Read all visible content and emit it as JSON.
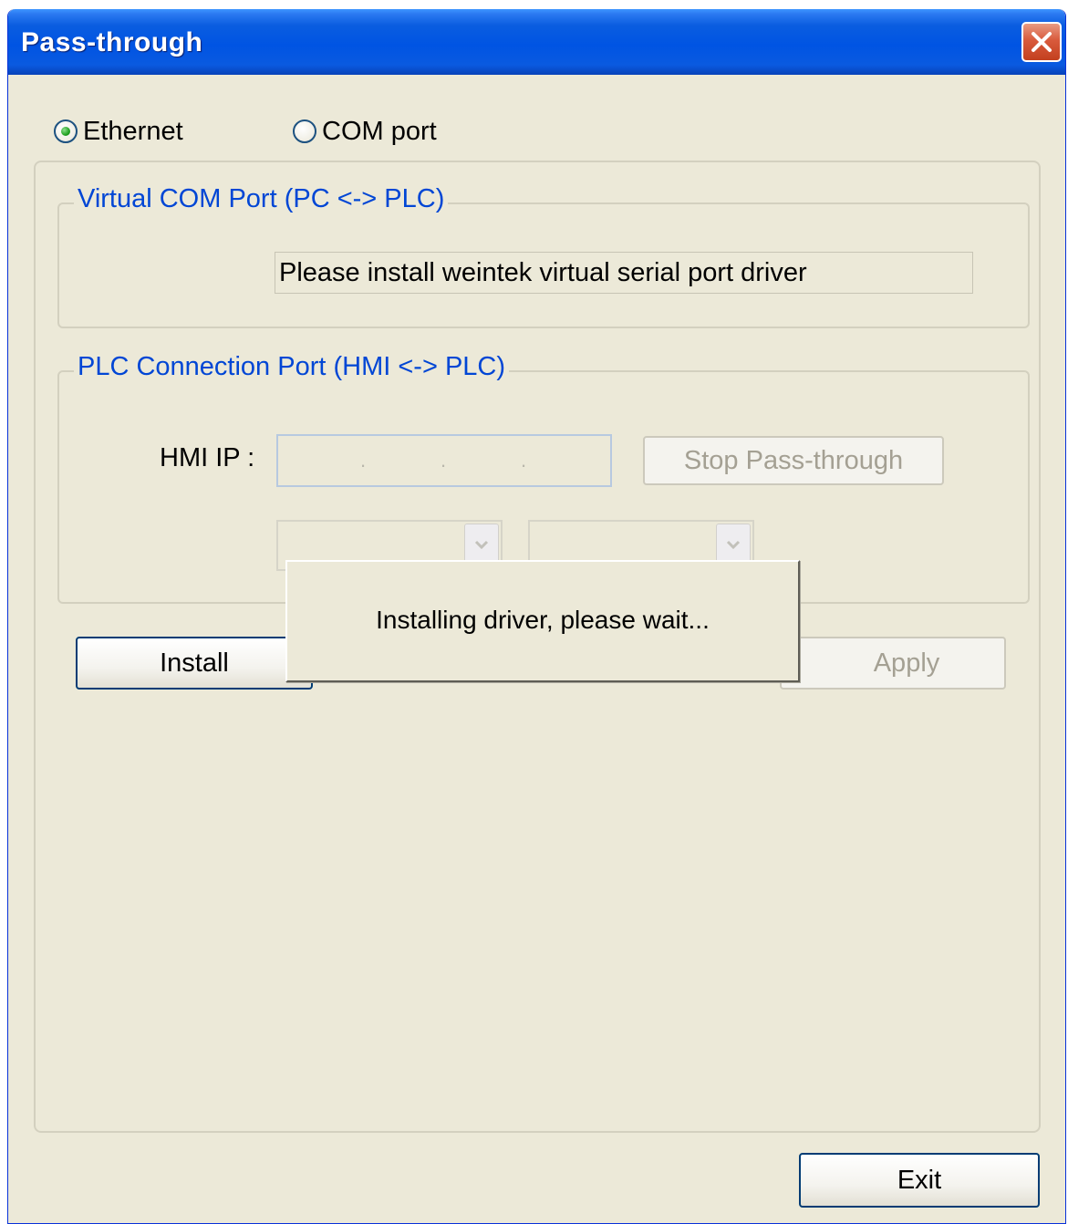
{
  "window": {
    "title": "Pass-through"
  },
  "connection_type": {
    "ethernet_label": "Ethernet",
    "com_port_label": "COM port",
    "selected": "Ethernet"
  },
  "virtual_com_group": {
    "legend": "Virtual COM Port (PC <-> PLC)",
    "status_text": "Please install weintek virtual serial port driver"
  },
  "plc_connection_group": {
    "legend": "PLC Connection Port (HMI <-> PLC)",
    "hmi_ip_label": "HMI IP :",
    "ip_separators": [
      ".",
      ".",
      "."
    ],
    "stop_button_label": "Stop Pass-through"
  },
  "actions": {
    "install_label": "Install",
    "apply_label": "Apply",
    "exit_label": "Exit"
  },
  "popup": {
    "message": "Installing driver, please wait..."
  },
  "colors": {
    "dialog_bg": "#ECE9D8",
    "title_bar": "#0054E3",
    "group_legend": "#0046D5",
    "disabled_text": "#A4A093"
  }
}
